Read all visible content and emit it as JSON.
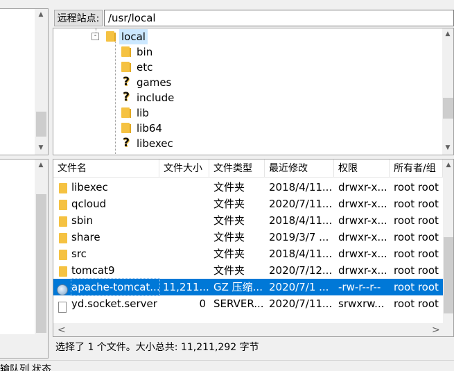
{
  "remote_site": {
    "label": "远程站点:",
    "path": "/usr/local"
  },
  "tree": {
    "items": [
      {
        "label": "local",
        "icon": "folder-icon",
        "expander": "-"
      },
      {
        "label": "bin",
        "icon": "folder-icon"
      },
      {
        "label": "etc",
        "icon": "folder-icon"
      },
      {
        "label": "games",
        "icon": "unknown-folder-icon"
      },
      {
        "label": "include",
        "icon": "unknown-folder-icon"
      },
      {
        "label": "lib",
        "icon": "folder-icon"
      },
      {
        "label": "lib64",
        "icon": "folder-icon"
      },
      {
        "label": "libexec",
        "icon": "unknown-folder-icon"
      }
    ]
  },
  "file_list": {
    "columns": [
      "文件名",
      "文件大小",
      "文件类型",
      "最近修改",
      "权限",
      "所有者/组"
    ],
    "rows": [
      {
        "name": "libexec",
        "size": "",
        "type": "文件夹",
        "modified": "2018/4/11...",
        "perms": "drwxr-x...",
        "owner": "root root",
        "icon": "folder-icon"
      },
      {
        "name": "qcloud",
        "size": "",
        "type": "文件夹",
        "modified": "2020/7/11...",
        "perms": "drwxr-x...",
        "owner": "root root",
        "icon": "folder-icon"
      },
      {
        "name": "sbin",
        "size": "",
        "type": "文件夹",
        "modified": "2018/4/11...",
        "perms": "drwxr-x...",
        "owner": "root root",
        "icon": "folder-icon"
      },
      {
        "name": "share",
        "size": "",
        "type": "文件夹",
        "modified": "2019/3/7 ...",
        "perms": "drwxr-x...",
        "owner": "root root",
        "icon": "folder-icon"
      },
      {
        "name": "src",
        "size": "",
        "type": "文件夹",
        "modified": "2018/4/11...",
        "perms": "drwxr-x...",
        "owner": "root root",
        "icon": "folder-icon"
      },
      {
        "name": "tomcat9",
        "size": "",
        "type": "文件夹",
        "modified": "2020/7/12...",
        "perms": "drwxr-x...",
        "owner": "root root",
        "icon": "folder-icon"
      },
      {
        "name": "apache-tomcat...",
        "size": "11,211...",
        "type": "GZ 压缩...",
        "modified": "2020/7/1 ...",
        "perms": "-rw-r--r--",
        "owner": "root root",
        "icon": "archive-icon",
        "selected": true
      },
      {
        "name": "yd.socket.server",
        "size": "0",
        "type": "SERVER...",
        "modified": "2020/7/11...",
        "perms": "srwxrw...",
        "owner": "root root",
        "icon": "file-icon"
      }
    ]
  },
  "status": {
    "text": "选择了 1 个文件。大小总共: 11,211,292 字节"
  },
  "bottom_tabs": {
    "left": "传输队列",
    "right": "状态"
  },
  "colors": {
    "selection": "#0078d7",
    "folder": "#f5c242"
  }
}
